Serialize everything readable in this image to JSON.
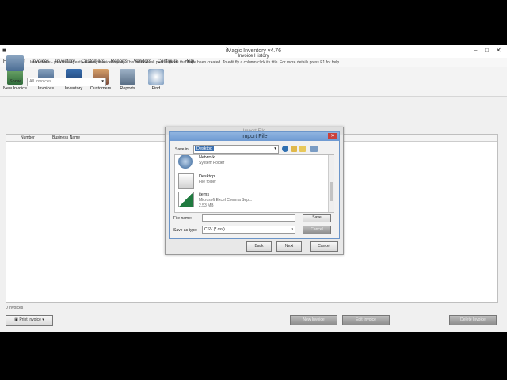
{
  "window": {
    "title": "iMagic Inventory v4.76"
  },
  "menu": [
    "File",
    "Edit",
    "Invoices",
    "Inventory",
    "Customers",
    "Reports",
    "Vendors",
    "Configure",
    "Help"
  ],
  "toolbar": {
    "new_invoice": "New Invoice",
    "invoices": "Invoices",
    "inventory": "Inventory",
    "customers": "Customers",
    "reports": "Reports",
    "find": "Find"
  },
  "page": {
    "title": "Invoice History",
    "instructions": "Instructions - you are currently viewing Invoice History. This includes all past invoices that have been created. To edit fly a column click its title. For more details press F1 for help.",
    "show_label": "Show:",
    "show_value": "All Invoices",
    "columns": [
      "Number",
      "Business Name"
    ],
    "status": "0 invoices",
    "print_button": "Print Invoice",
    "bottom_buttons": [
      "New Invoice",
      "Edit Invoice",
      "Delete Invoice"
    ]
  },
  "import_dialog": {
    "title": "Import File",
    "back": "Back",
    "next": "Next",
    "cancel": "Cancel"
  },
  "file_dialog": {
    "title": "Import File",
    "save_in_label": "Save in:",
    "save_in_value": "Desktop",
    "items": [
      {
        "name": "Network",
        "sub": "System Folder"
      },
      {
        "name": "Desktop",
        "sub": "File folder"
      },
      {
        "name": "items",
        "sub": "Microsoft Excel Comma Sep...",
        "size": "2.53 MB"
      }
    ],
    "file_name_label": "File name:",
    "file_name_value": "",
    "save_type_label": "Save as type:",
    "save_type_value": "CSV (*.csv)",
    "save_button": "Save",
    "cancel_button": "Cancel"
  },
  "colors": {
    "accent": "#6e9ad2",
    "close": "#c9413b"
  }
}
